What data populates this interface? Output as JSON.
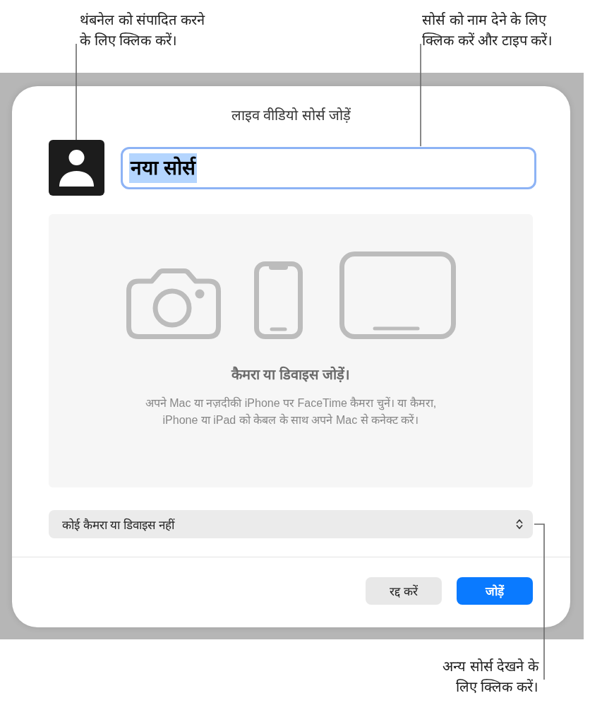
{
  "callouts": [
    {
      "kind": "thumbnail",
      "lines": [
        "थंबनेल को संपादित करने",
        "के लिए क्लिक करें।"
      ]
    },
    {
      "kind": "field",
      "lines": [
        "सोर्स को नाम देने के लिए",
        "क्लिक करें और टाइप करें।"
      ]
    },
    {
      "kind": "popup",
      "lines": [
        "अन्य सोर्स देखने के",
        "लिए क्लिक करें।"
      ]
    }
  ],
  "dialog": {
    "title": "लाइव वीडियो सोर्स जोड़ें",
    "name_field": {
      "value": "नया सोर्स",
      "focused": true,
      "text_selected": true
    },
    "empty_state": {
      "heading": "कैमरा या डिवाइस जोड़ें।",
      "description_lines": [
        "अपने Mac या नज़दीकी iPhone पर FaceTime कैमरा चुनें। या कैमरा,",
        "iPhone या iPad को केबल के साथ अपने Mac से कनेक्ट करें।"
      ]
    },
    "source_popup": {
      "value": "कोई कैमरा या डिवाइस नहीं"
    },
    "buttons": [
      {
        "label": "रद्द करें",
        "kind": "secondary"
      },
      {
        "label": "जोड़ें",
        "kind": "primary"
      }
    ]
  }
}
